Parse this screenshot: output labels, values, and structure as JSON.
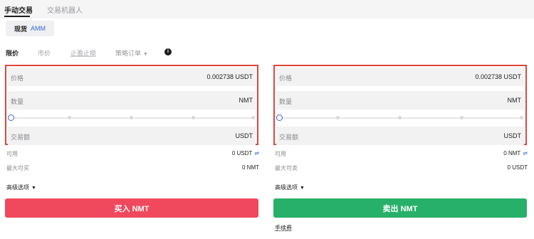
{
  "tabs": {
    "manual": "手动交易",
    "robot": "交易机器人"
  },
  "subtab": {
    "spot": "现货",
    "amm": "AMM"
  },
  "order_types": {
    "limit": "限价",
    "market": "市价",
    "tp_sl": "止盈止损",
    "strategy": "策略订单"
  },
  "buy": {
    "price_label": "价格",
    "price_value": "0.002738 USDT",
    "qty_label": "数量",
    "qty_unit": "NMT",
    "amount_label": "交易额",
    "amount_unit": "USDT",
    "available_label": "可用",
    "available_value": "0 USDT",
    "max_label": "最大可买",
    "max_value": "0 NMT",
    "advanced": "高级选项",
    "button": "买入 NMT",
    "slider_value": 0
  },
  "sell": {
    "price_label": "价格",
    "price_value": "0.002738 USDT",
    "qty_label": "数量",
    "qty_unit": "NMT",
    "amount_label": "交易额",
    "amount_unit": "USDT",
    "available_label": "可用",
    "available_value": "0 NMT",
    "max_label": "最大可卖",
    "max_value": "0 USDT",
    "advanced": "高级选项",
    "button": "卖出 NMT",
    "slider_value": 0
  },
  "fee_label": "手续费",
  "colors": {
    "buy": "#f0485d",
    "sell": "#27b06a",
    "highlight": "#e0453c",
    "accent": "#3a66d1"
  }
}
